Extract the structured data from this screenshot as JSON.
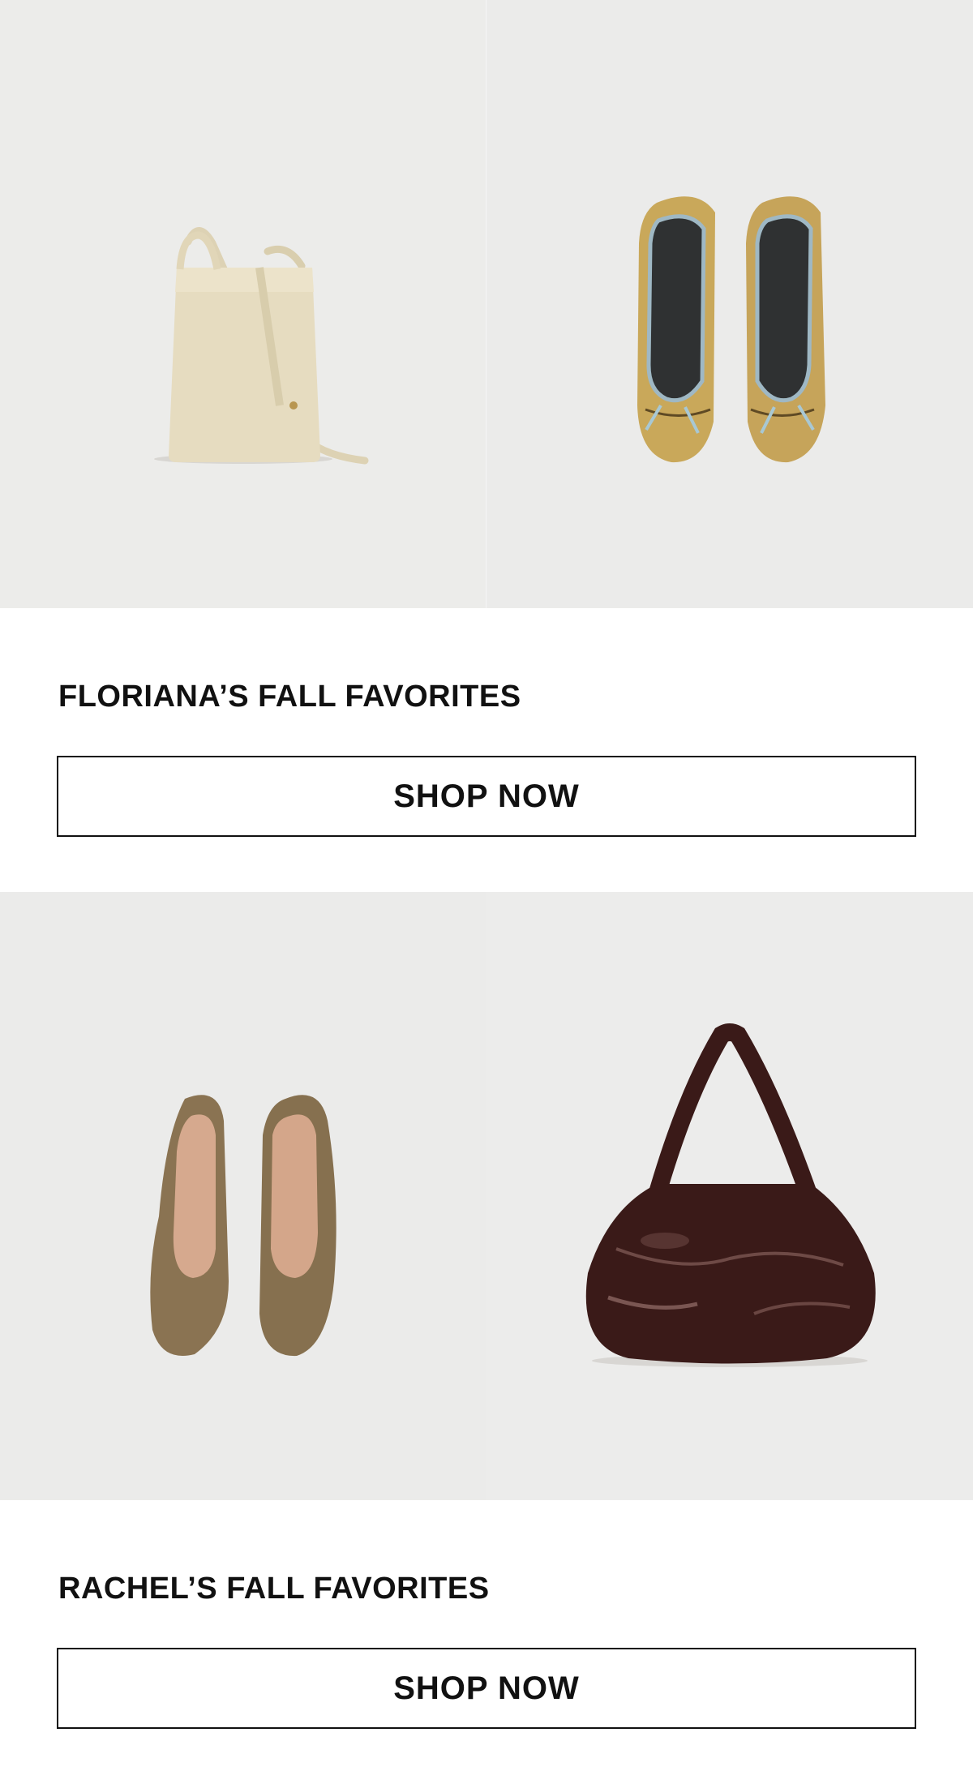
{
  "sections": [
    {
      "title": "FLORIANA’S FALL FAVORITES",
      "button_label": "SHOP NOW",
      "products": [
        {
          "name": "cream-crossbody-bag",
          "icon": "bag-icon"
        },
        {
          "name": "snakeskin-ballet-flats",
          "icon": "shoe-icon"
        }
      ]
    },
    {
      "title": "RACHEL’S FALL FAVORITES",
      "button_label": "SHOP NOW",
      "products": [
        {
          "name": "suede-pointed-flats",
          "icon": "shoe-icon"
        },
        {
          "name": "patent-hobo-bag",
          "icon": "bag-icon"
        }
      ]
    }
  ],
  "colors": {
    "background": "#ffffff",
    "tile": "#ececea",
    "text": "#111111",
    "cream_bag": "#e6dcc0",
    "snake_flat": "#c9a85a",
    "suede_flat": "#8a7352",
    "patent_bag": "#3a1a18"
  }
}
